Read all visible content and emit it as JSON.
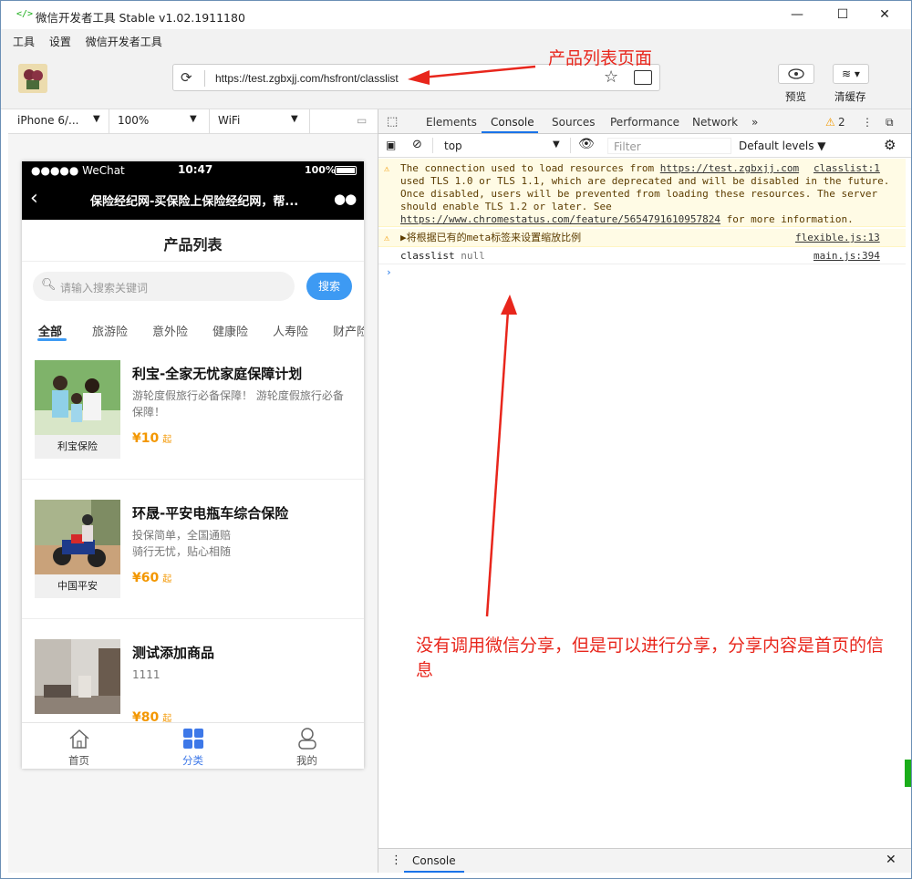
{
  "window": {
    "title": "微信开发者工具 Stable v1.02.1911180",
    "logo": "</>"
  },
  "menu": [
    "工具",
    "设置",
    "微信开发者工具"
  ],
  "toolbar": {
    "url": "https://test.zgbxjj.com/hsfront/classlist",
    "preview_label": "预览",
    "clear_cache_label": "清缓存"
  },
  "simulator": {
    "device": "iPhone 6/...",
    "zoom": "100%",
    "network": "WiFi"
  },
  "phone": {
    "carrier": "●●●●● WeChat",
    "time": "10:47",
    "battery": "100%",
    "nav_title": "保险经纪网-买保险上保险经纪网，帮...",
    "page_title": "产品列表",
    "search_placeholder": "请输入搜索关键词",
    "search_button": "搜索",
    "categories": [
      "全部",
      "旅游险",
      "意外险",
      "健康险",
      "人寿险",
      "财产险"
    ],
    "products": [
      {
        "name": "利宝-全家无忧家庭保障计划",
        "desc": "游轮度假旅行必备保障！ 游轮度假旅行必备保障！",
        "price": "¥10",
        "price_suffix": "起",
        "brand": "利宝保险"
      },
      {
        "name": "环晟-平安电瓶车综合保险",
        "desc": "投保简单，全国通赔\n骑行无忧，贴心相随",
        "price": "¥60",
        "price_suffix": "起",
        "brand": "中国平安"
      },
      {
        "name": "测试添加商品",
        "desc": "1111",
        "price": "¥80",
        "price_suffix": "起",
        "brand": ""
      }
    ],
    "tabbar": [
      "首页",
      "分类",
      "我的"
    ]
  },
  "devtools": {
    "tabs": [
      "Elements",
      "Console",
      "Sources",
      "Performance",
      "Network"
    ],
    "warn_count": "2",
    "context": "top",
    "filter_placeholder": "Filter",
    "levels": "Default levels ▼",
    "messages": {
      "tls_text_1": "The connection used to load resources from ",
      "tls_link": "https://test.zgbxjj.com",
      "tls_source": "classlist:1",
      "tls_text_2": "used TLS 1.0 or TLS 1.1, which are deprecated and will be disabled in the future. Once disabled, users will be prevented from loading these resources. The server should enable TLS 1.2 or later. See ",
      "tls_link2": "https://www.chromestatus.com/feature/5654791610957824",
      "tls_text_3": " for more information.",
      "meta_text": "▶将根据已有的meta标签来设置缩放比例",
      "meta_source": "flexible.js:13",
      "log_text": "classlist",
      "log_value": "null",
      "log_source": "main.js:394"
    },
    "drawer_tab": "Console"
  },
  "annotations": {
    "top": "产品列表页面",
    "bottom": "没有调用微信分享，但是可以进行分享，分享内容是首页的信息"
  },
  "colors": {
    "accent": "#3d9af3",
    "price": "#f39700",
    "annotation": "#e8261c"
  }
}
